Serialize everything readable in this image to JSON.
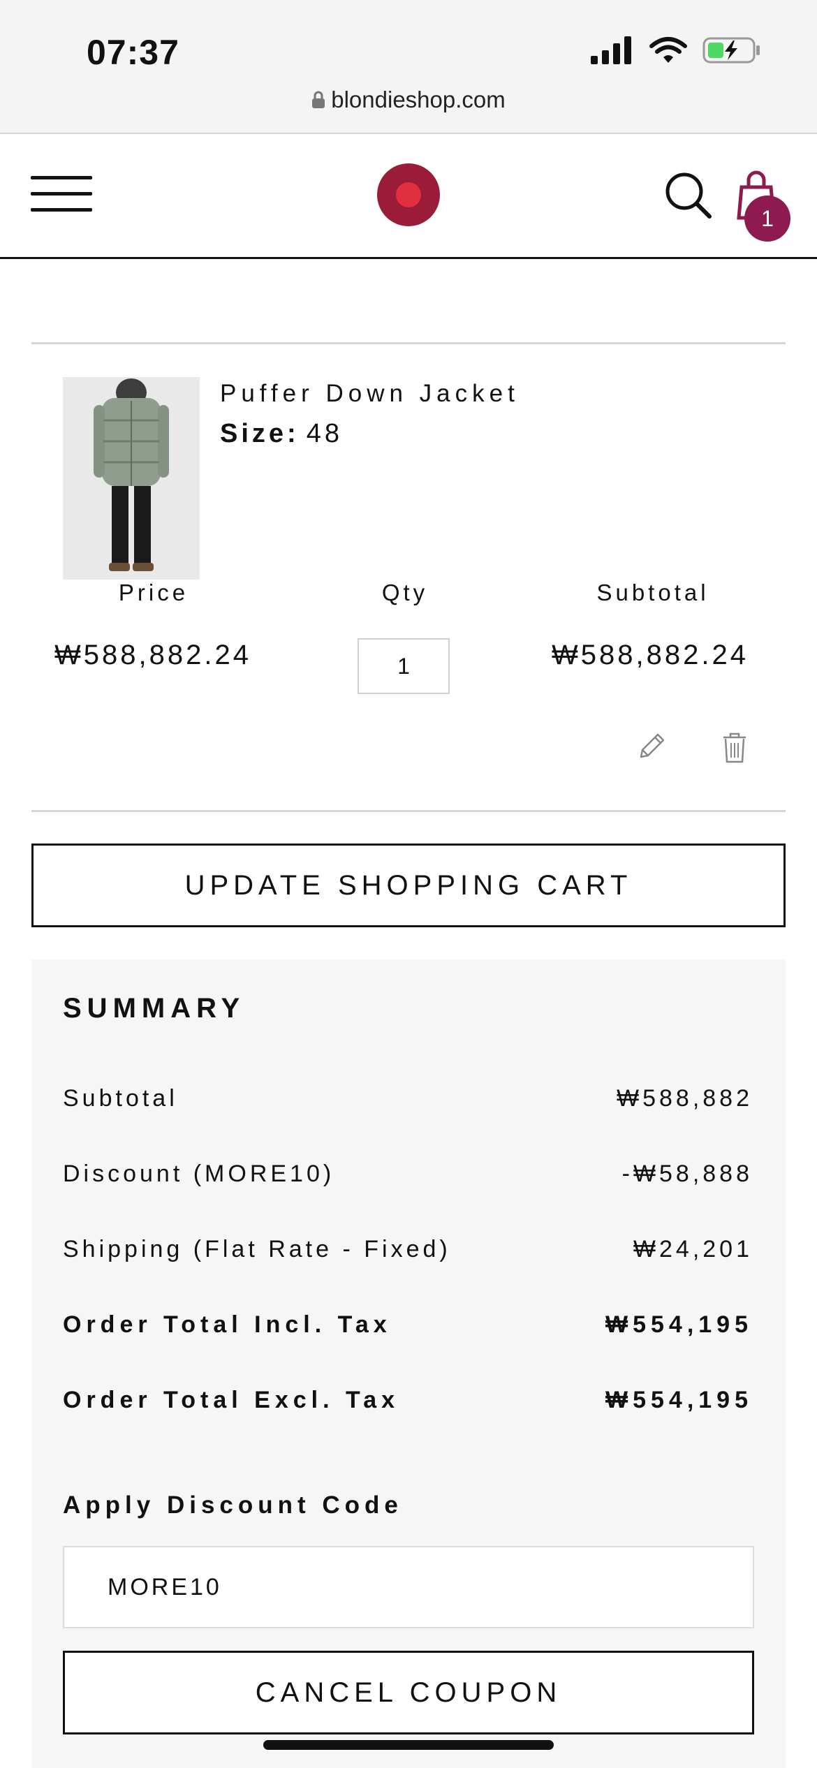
{
  "status_bar": {
    "time": "07:37",
    "url": "blondieshop.com",
    "icons": [
      "signal-icon",
      "wifi-icon",
      "battery-charging-icon"
    ]
  },
  "header": {
    "icons": [
      "menu-icon",
      "logo",
      "search-icon",
      "shopping-bag-icon"
    ],
    "cart_count": "1",
    "colors": {
      "logo": "#9b1c39",
      "logo_dot": "#e0303d",
      "badge": "#8e1b4f"
    }
  },
  "cart_item": {
    "name": "Puffer Down Jacket",
    "size_label": "Size:",
    "size_value": "48",
    "price_label": "Price",
    "qty_label": "Qty",
    "subtotal_label": "Subtotal",
    "price": "₩588,882.24",
    "qty": "1",
    "subtotal": "₩588,882.24",
    "action_icons": [
      "pencil-icon",
      "trash-icon"
    ]
  },
  "update_button": "UPDATE SHOPPING CART",
  "summary": {
    "title": "SUMMARY",
    "rows": [
      {
        "label": "Subtotal",
        "value": "₩588,882"
      },
      {
        "label": "Discount (MORE10)",
        "value": "-₩58,888"
      },
      {
        "label": "Shipping (Flat Rate - Fixed)",
        "value": "₩24,201"
      },
      {
        "label": "Order Total Incl. Tax",
        "value": "₩554,195"
      },
      {
        "label": "Order Total Excl. Tax",
        "value": "₩554,195"
      }
    ],
    "discount_label": "Apply Discount Code",
    "discount_value": "MORE10",
    "cancel_button": "CANCEL COUPON"
  }
}
